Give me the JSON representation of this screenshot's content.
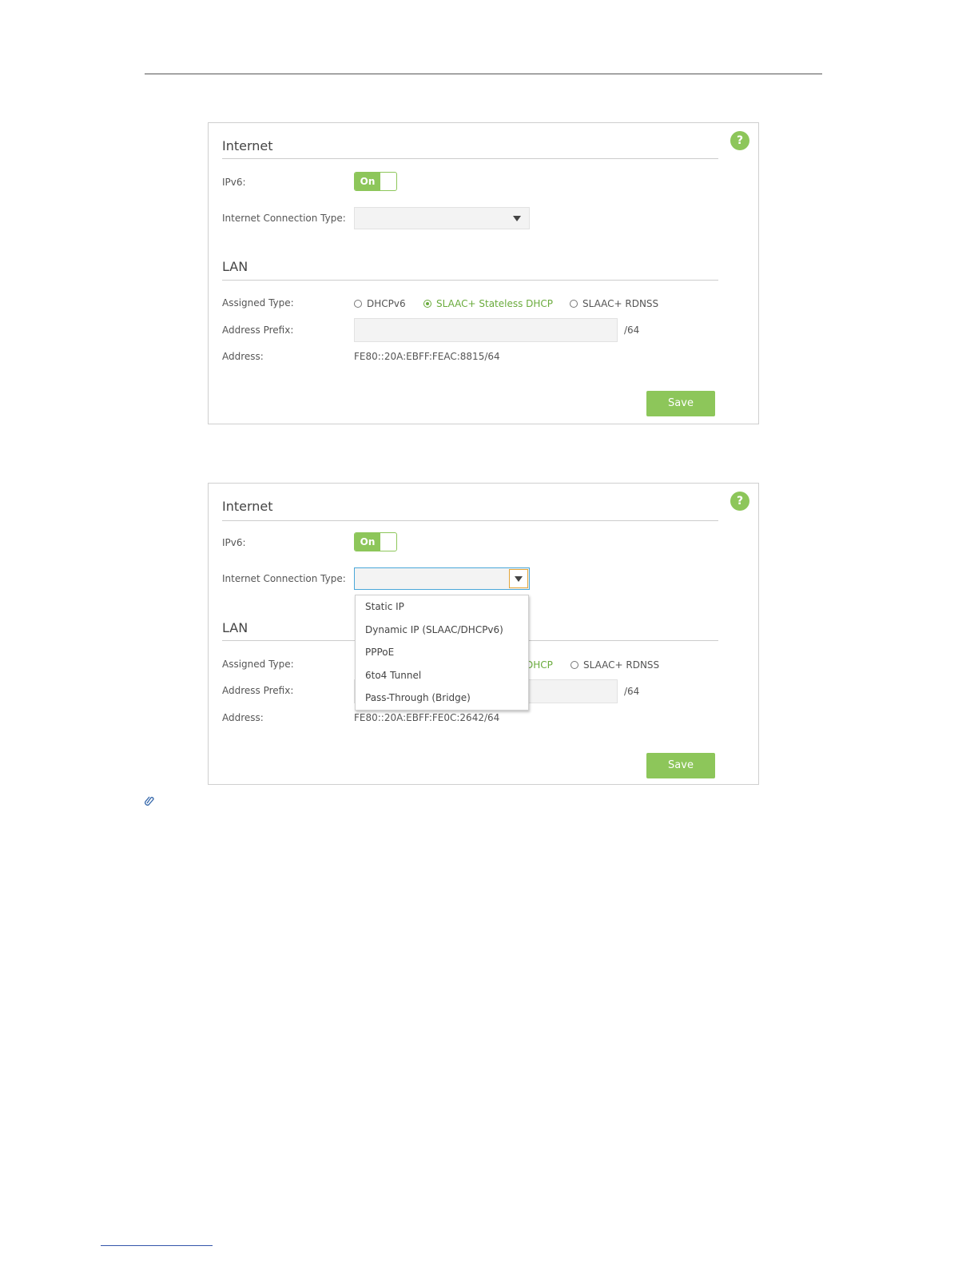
{
  "panels": [
    {
      "internet_title": "Internet",
      "ipv6_label": "IPv6:",
      "toggle_label": "On",
      "connection_type_label": "Internet Connection Type:",
      "connection_type_value": "",
      "lan_title": "LAN",
      "assigned_type_label": "Assigned Type:",
      "assigned_options": [
        "DHCPv6",
        "SLAAC+ Stateless DHCP",
        "SLAAC+ RDNSS"
      ],
      "assigned_selected": "SLAAC+ Stateless DHCP",
      "address_prefix_label": "Address Prefix:",
      "address_prefix_value": "",
      "prefix_suffix": "/64",
      "address_label": "Address:",
      "address_value": "FE80::20A:EBFF:FEAC:8815/64",
      "save_label": "Save",
      "help_icon": "?"
    },
    {
      "internet_title": "Internet",
      "ipv6_label": "IPv6:",
      "toggle_label": "On",
      "connection_type_label": "Internet Connection Type:",
      "connection_type_value": "",
      "dropdown_options": [
        "Static IP",
        "Dynamic IP (SLAAC/DHCPv6)",
        "PPPoE",
        "6to4 Tunnel",
        "Pass-Through (Bridge)"
      ],
      "lan_title": "LAN",
      "assigned_type_label": "Assigned Type:",
      "visible_assigned_fragment": "DHCP",
      "visible_assigned_option": "SLAAC+ RDNSS",
      "address_prefix_label": "Address Prefix:",
      "prefix_suffix": "/64",
      "address_label": "Address:",
      "address_value": "FE80::20A:EBFF:FE0C:2642/64",
      "save_label": "Save",
      "help_icon": "?"
    }
  ],
  "colors": {
    "accent_green": "#8dc65a",
    "selected_text": "#6aab3c",
    "focus_blue": "#4aa7d9",
    "focus_orange": "#e3a53a"
  },
  "icons": [
    "help-icon",
    "dropdown-arrow-icon",
    "paperclip-icon"
  ]
}
